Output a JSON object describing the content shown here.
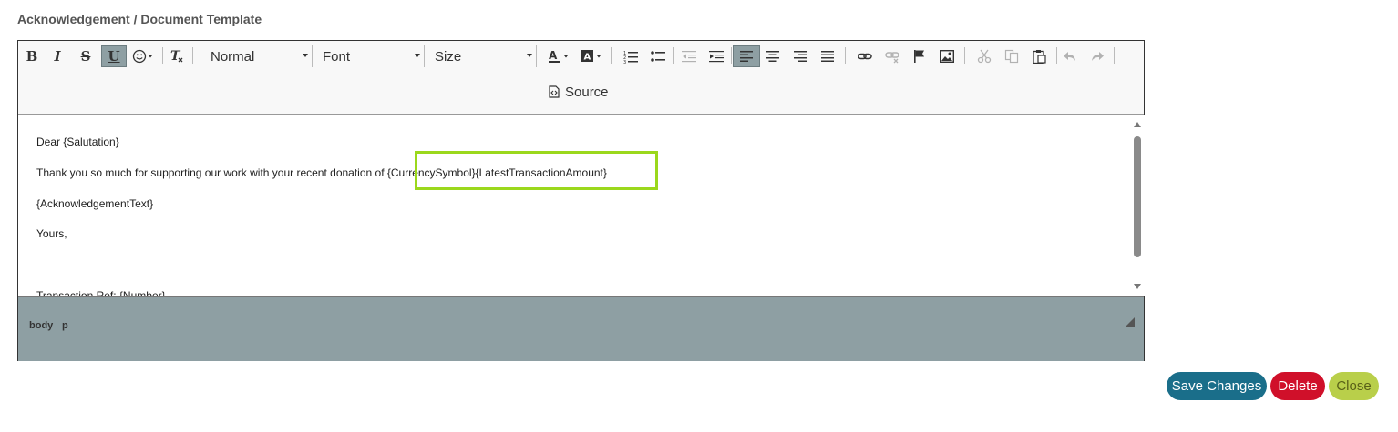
{
  "page": {
    "title": "Acknowledgement / Document Template"
  },
  "toolbar": {
    "bold": "B",
    "italic": "I",
    "strike": "S",
    "underline": "U",
    "format_value": "Normal",
    "font_value": "Font",
    "size_value": "Size",
    "source_label": "Source"
  },
  "content": {
    "lines": [
      "Dear {Salutation}",
      "Thank you so much for supporting our work with your recent donation of {CurrencySymbol}{LatestTransactionAmount}",
      "{AcknowledgementText}",
      "Yours,",
      "Transaction Ref: {Number}"
    ]
  },
  "statusbar": {
    "path": [
      "body",
      "p"
    ]
  },
  "actions": {
    "save": "Save Changes",
    "delete": "Delete",
    "close": "Close"
  },
  "colors": {
    "highlight": "#9bd81c",
    "save": "#1a6e8a",
    "delete": "#d0102a",
    "close": "#b9cf4a",
    "statusbar": "#8e9fa3"
  }
}
